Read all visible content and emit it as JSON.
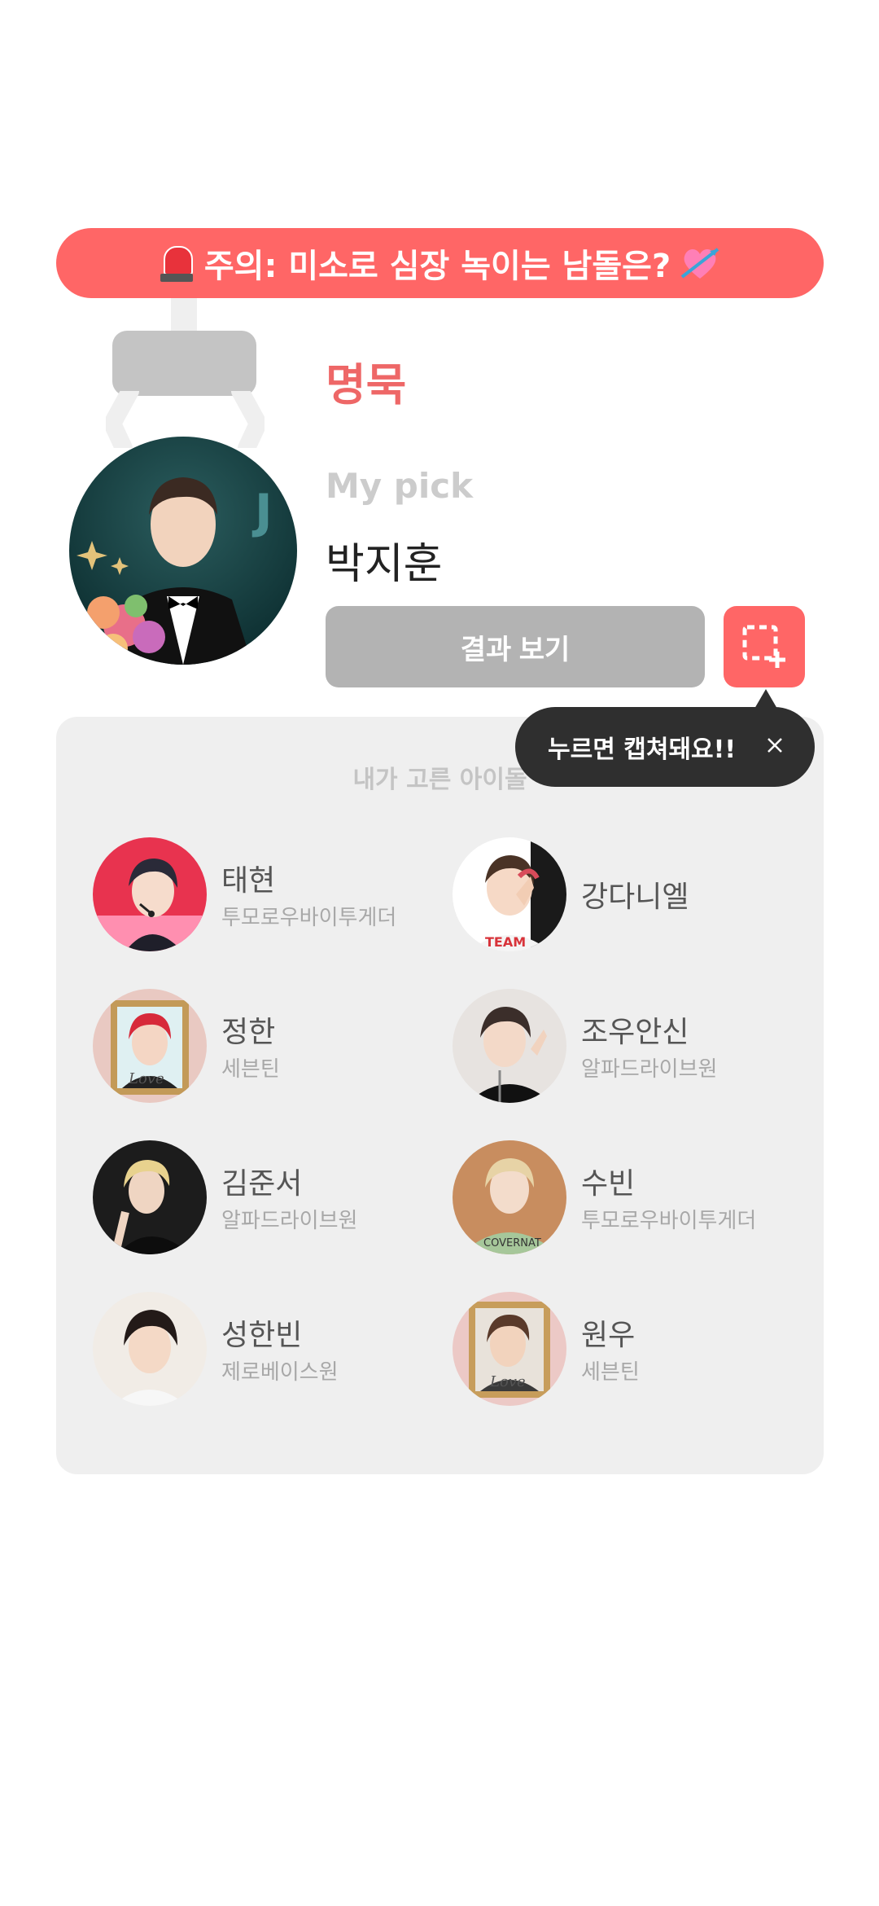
{
  "banner": {
    "text": "주의: 미소로 심장 녹이는 남돌은?",
    "left_icon": "siren-icon",
    "right_icon": "heart-arrow-icon"
  },
  "pick": {
    "mbti": "명묵",
    "label": "My pick",
    "name": "박지훈",
    "result_button": "결과 보기",
    "capture_icon": "screen-capture-icon"
  },
  "tooltip": {
    "text": "누르면 캡쳐돼요!!"
  },
  "card": {
    "title": "내가 고른 아이돌",
    "people": [
      {
        "name": "태현",
        "group": "투모로우바이투게더"
      },
      {
        "name": "강다니엘",
        "group": ""
      },
      {
        "name": "정한",
        "group": "세븐틴"
      },
      {
        "name": "조우안신",
        "group": "알파드라이브원"
      },
      {
        "name": "김준서",
        "group": "알파드라이브원"
      },
      {
        "name": "수빈",
        "group": "투모로우바이투게더"
      },
      {
        "name": "성한빈",
        "group": "제로베이스원"
      },
      {
        "name": "원우",
        "group": "세븐틴"
      }
    ]
  },
  "colors": {
    "accent": "#ff6666",
    "mbti": "#ee6767",
    "card_bg": "#efefef",
    "button_gray": "#b3b3b3",
    "tooltip_bg": "#2f2f2f"
  }
}
